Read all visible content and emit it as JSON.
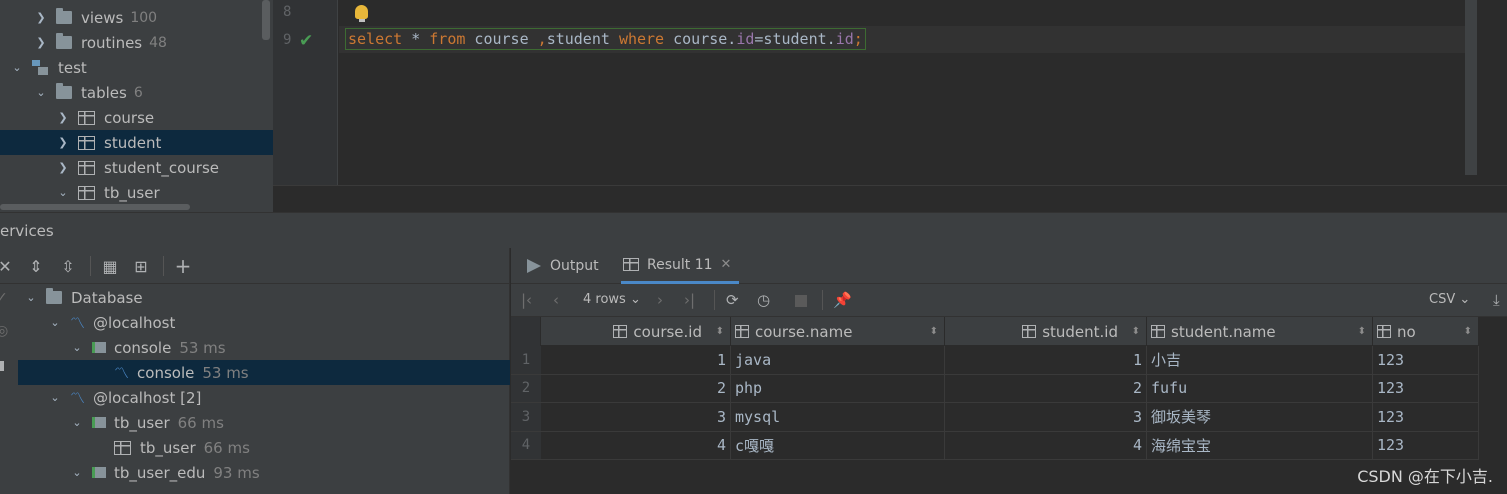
{
  "db_tree": {
    "rows": [
      {
        "label": "views",
        "count": "100"
      },
      {
        "label": "routines",
        "count": "48"
      },
      {
        "label": "test",
        "count": ""
      },
      {
        "label": "tables",
        "count": "6"
      },
      {
        "label": "course",
        "count": ""
      },
      {
        "label": "student",
        "count": ""
      },
      {
        "label": "student_course",
        "count": ""
      },
      {
        "label": "tb_user",
        "count": ""
      }
    ]
  },
  "editor": {
    "line_numbers": [
      "8",
      "9"
    ],
    "code": {
      "t1": "select",
      "t2": " * ",
      "t3": "from",
      "t4": " course ",
      "t5": ",",
      "t6": "student ",
      "t7": "where",
      "t8": " course.",
      "t9": "id",
      "t10": "=student.",
      "t11": "id",
      "t12": ";"
    }
  },
  "services": {
    "title": "ervices",
    "tree": [
      {
        "label": "Database",
        "ms": ""
      },
      {
        "label": "@localhost",
        "ms": ""
      },
      {
        "label": "console",
        "ms": "53 ms"
      },
      {
        "label": "console",
        "ms": "53 ms"
      },
      {
        "label": "@localhost [2]",
        "ms": ""
      },
      {
        "label": "tb_user",
        "ms": "66 ms"
      },
      {
        "label": "tb_user",
        "ms": "66 ms"
      },
      {
        "label": "tb_user_edu",
        "ms": "93 ms"
      }
    ]
  },
  "result": {
    "tabs": [
      {
        "label": "Output"
      },
      {
        "label": "Result 11"
      }
    ],
    "rows_label": "4 rows",
    "export_format": "CSV",
    "columns": [
      "course.id",
      "course.name",
      "student.id",
      "student.name",
      "no"
    ],
    "rows": [
      {
        "n": "1",
        "c": [
          "1",
          "java",
          "1",
          "小吉",
          "123"
        ]
      },
      {
        "n": "2",
        "c": [
          "2",
          "php",
          "2",
          "fufu",
          "123"
        ]
      },
      {
        "n": "3",
        "c": [
          "3",
          "mysql",
          "3",
          "御坂美琴",
          "123"
        ]
      },
      {
        "n": "4",
        "c": [
          "4",
          "c嘎嘎",
          "4",
          "海绵宝宝",
          "123"
        ]
      }
    ]
  },
  "watermark": "CSDN @在下小吉.",
  "colors": {
    "keyword": "#cc7832",
    "field": "#9876aa",
    "selection": "#0d293e",
    "accent": "#4a88c7"
  }
}
